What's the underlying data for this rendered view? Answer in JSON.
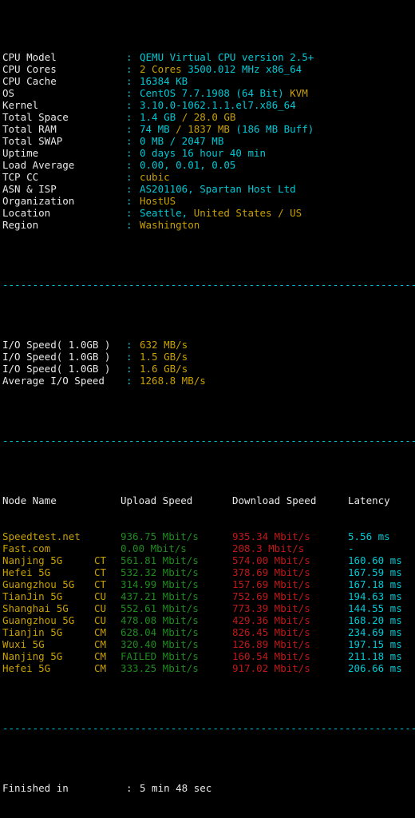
{
  "palette": {
    "background": "#000000",
    "white": "#e8e8e8",
    "cyan": "#00c8d4",
    "yellow": "#c8a000",
    "green": "#1f8a1f",
    "red": "#c01818"
  },
  "system_info": [
    {
      "label": "CPU Model",
      "colon": ":",
      "parts": [
        {
          "text": "QEMU Virtual CPU version 2.5+",
          "color": "cyan"
        }
      ]
    },
    {
      "label": "CPU Cores",
      "colon": ":",
      "parts": [
        {
          "text": "2 Cores ",
          "color": "yellow"
        },
        {
          "text": "3500.012 MHz x86_64",
          "color": "cyan"
        }
      ]
    },
    {
      "label": "CPU Cache",
      "colon": ":",
      "parts": [
        {
          "text": "16384 KB",
          "color": "cyan"
        }
      ]
    },
    {
      "label": "OS",
      "colon": ":",
      "parts": [
        {
          "text": "CentOS 7.7.1908 (64 Bit) ",
          "color": "cyan"
        },
        {
          "text": "KVM",
          "color": "yellow"
        }
      ]
    },
    {
      "label": "Kernel",
      "colon": ":",
      "parts": [
        {
          "text": "3.10.0-1062.1.1.el7.x86_64",
          "color": "cyan"
        }
      ]
    },
    {
      "label": "Total Space",
      "colon": ":",
      "parts": [
        {
          "text": "1.4 GB ",
          "color": "cyan"
        },
        {
          "text": "/ 28.0 GB",
          "color": "yellow"
        }
      ]
    },
    {
      "label": "Total RAM",
      "colon": ":",
      "parts": [
        {
          "text": "74 MB ",
          "color": "cyan"
        },
        {
          "text": "/ 1837 MB ",
          "color": "yellow"
        },
        {
          "text": "(186 MB Buff)",
          "color": "cyan"
        }
      ]
    },
    {
      "label": "Total SWAP",
      "colon": ":",
      "parts": [
        {
          "text": "0 MB / 2047 MB",
          "color": "cyan"
        }
      ]
    },
    {
      "label": "Uptime",
      "colon": ":",
      "parts": [
        {
          "text": "0 days 16 hour 40 min",
          "color": "cyan"
        }
      ]
    },
    {
      "label": "Load Average",
      "colon": ":",
      "parts": [
        {
          "text": "0.00, 0.01, 0.05",
          "color": "cyan"
        }
      ]
    },
    {
      "label": "TCP CC",
      "colon": ":",
      "parts": [
        {
          "text": "cubic",
          "color": "yellow"
        }
      ]
    },
    {
      "label": "ASN & ISP",
      "colon": ":",
      "parts": [
        {
          "text": "AS201106, Spartan Host Ltd",
          "color": "cyan"
        }
      ]
    },
    {
      "label": "Organization",
      "colon": ":",
      "parts": [
        {
          "text": "HostUS",
          "color": "yellow"
        }
      ]
    },
    {
      "label": "Location",
      "colon": ":",
      "parts": [
        {
          "text": "Seattle, ",
          "color": "cyan"
        },
        {
          "text": "United States / US",
          "color": "yellow"
        }
      ]
    },
    {
      "label": "Region",
      "colon": ":",
      "parts": [
        {
          "text": "Washington",
          "color": "yellow"
        }
      ]
    }
  ],
  "separator": "----------------------------------------------------------------------",
  "io_tests": [
    {
      "label": "I/O Speed( 1.0GB )",
      "colon": ":",
      "value": "632 MB/s",
      "color": "yellow"
    },
    {
      "label": "I/O Speed( 1.0GB )",
      "colon": ":",
      "value": "1.5 GB/s",
      "color": "yellow"
    },
    {
      "label": "I/O Speed( 1.0GB )",
      "colon": ":",
      "value": "1.6 GB/s",
      "color": "yellow"
    },
    {
      "label": "Average I/O Speed",
      "colon": ":",
      "value": "1268.8 MB/s",
      "color": "yellow"
    }
  ],
  "speedtest": {
    "headers": {
      "node": "Node Name",
      "operator": "",
      "upload": "Upload Speed",
      "download": "Download Speed",
      "latency": "Latency"
    },
    "rows": [
      {
        "node": "Speedtest.net",
        "operator": "",
        "upload": "936.75 Mbit/s",
        "download": "935.34 Mbit/s",
        "latency": "5.56 ms"
      },
      {
        "node": "Fast.com",
        "operator": "",
        "upload": "0.00 Mbit/s",
        "download": "208.3 Mbit/s",
        "latency": "-"
      },
      {
        "node": "Nanjing 5G",
        "operator": "CT",
        "upload": "561.81 Mbit/s",
        "download": "574.00 Mbit/s",
        "latency": "160.60 ms"
      },
      {
        "node": "Hefei 5G",
        "operator": "CT",
        "upload": "532.32 Mbit/s",
        "download": "378.69 Mbit/s",
        "latency": "167.59 ms"
      },
      {
        "node": "Guangzhou 5G",
        "operator": "CT",
        "upload": "314.99 Mbit/s",
        "download": "157.69 Mbit/s",
        "latency": "167.18 ms"
      },
      {
        "node": "TianJin 5G",
        "operator": "CU",
        "upload": "437.21 Mbit/s",
        "download": "752.69 Mbit/s",
        "latency": "194.63 ms"
      },
      {
        "node": "Shanghai 5G",
        "operator": "CU",
        "upload": "552.61 Mbit/s",
        "download": "773.39 Mbit/s",
        "latency": "144.55 ms"
      },
      {
        "node": "Guangzhou 5G",
        "operator": "CU",
        "upload": "478.08 Mbit/s",
        "download": "429.36 Mbit/s",
        "latency": "168.20 ms"
      },
      {
        "node": "Tianjin 5G",
        "operator": "CM",
        "upload": "628.04 Mbit/s",
        "download": "826.45 Mbit/s",
        "latency": "234.69 ms"
      },
      {
        "node": "Wuxi 5G",
        "operator": "CM",
        "upload": "320.40 Mbit/s",
        "download": "126.89 Mbit/s",
        "latency": "197.15 ms"
      },
      {
        "node": "Nanjing 5G",
        "operator": "CM",
        "upload": "FAILED Mbit/s",
        "download": "160.54 Mbit/s",
        "latency": "211.18 ms"
      },
      {
        "node": "Hefei 5G",
        "operator": "CM",
        "upload": "333.25 Mbit/s",
        "download": "917.02 Mbit/s",
        "latency": "206.66 ms"
      }
    ]
  },
  "footer": {
    "label": "Finished in ",
    "colon": ":",
    "value": "5 min 48 sec"
  }
}
